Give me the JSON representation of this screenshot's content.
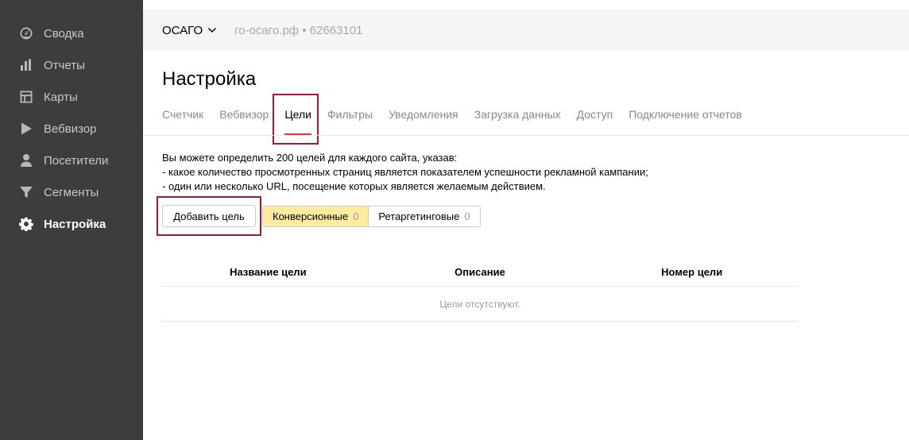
{
  "sidebar": {
    "items": [
      {
        "label": "Сводка",
        "icon": "dashboard-icon"
      },
      {
        "label": "Отчеты",
        "icon": "bar-chart-icon"
      },
      {
        "label": "Карты",
        "icon": "map-layout-icon"
      },
      {
        "label": "Вебвизор",
        "icon": "play-icon"
      },
      {
        "label": "Посетители",
        "icon": "user-icon"
      },
      {
        "label": "Сегменты",
        "icon": "filter-icon"
      },
      {
        "label": "Настройка",
        "icon": "gear-icon"
      }
    ],
    "active_index": 6
  },
  "topbar": {
    "counter_name": "ОСАГО",
    "site_info": "го-осаго.рф • 62663101"
  },
  "page": {
    "title": "Настройка"
  },
  "tabs": [
    {
      "label": "Счетчик"
    },
    {
      "label": "Вебвизор"
    },
    {
      "label": "Цели"
    },
    {
      "label": "Фильтры"
    },
    {
      "label": "Уведомления"
    },
    {
      "label": "Загрузка данных"
    },
    {
      "label": "Доступ"
    },
    {
      "label": "Подключение отчетов"
    }
  ],
  "goals": {
    "intro_line1": "Вы можете определить 200 целей для каждого сайта, указав:",
    "intro_line2": "-  какое количество просмотренных страниц является показателем успешности рекламной кампании;",
    "intro_line3": "-  один или несколько URL, посещение которых является желаемым действием.",
    "add_button_label": "Добавить цель",
    "filters": [
      {
        "label": "Конверсионные",
        "count": "0"
      },
      {
        "label": "Ретаргетинговые",
        "count": "0"
      }
    ],
    "columns": [
      "Название цели",
      "Описание",
      "Номер цели"
    ],
    "empty_text": "Цели отсутствуют."
  },
  "colors": {
    "sidebar_bg": "#3d3d3d",
    "active_tab_underline": "#e53935",
    "highlight_frame": "#a01c2c",
    "active_filter_bg": "#ffeba0"
  }
}
